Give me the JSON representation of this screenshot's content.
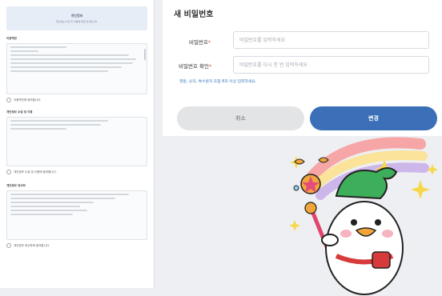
{
  "form": {
    "title": "새 비밀번호",
    "password_label": "비밀번호",
    "password_placeholder": "비밀번호를 입력하세요",
    "confirm_label": "비밀번호 확인",
    "confirm_placeholder": "비밀번호를 다시 한 번 입력하세요",
    "required_mark": "*",
    "hint": "영문, 숫자, 특수문자 조합 8자 이상 입력하세요.",
    "cancel_label": "취소",
    "change_label": "변경"
  },
  "left_panel": {
    "notice_title": "개인정보",
    "notice_text": "개인정보 수집 및 이용에 대한 안내입니다.",
    "section1_title": "이용약관",
    "agree1": "이용약관에 동의합니다.",
    "section2_title": "개인정보 수집 및 이용",
    "agree2": "개인정보 수집 및 이용에 동의합니다.",
    "section3_title": "개인정보 위수탁",
    "agree3": "개인정보 위수탁에 동의합니다."
  },
  "colors": {
    "accent": "#3b6fb8",
    "hint": "#3a7ac0",
    "required": "#e2483d"
  }
}
